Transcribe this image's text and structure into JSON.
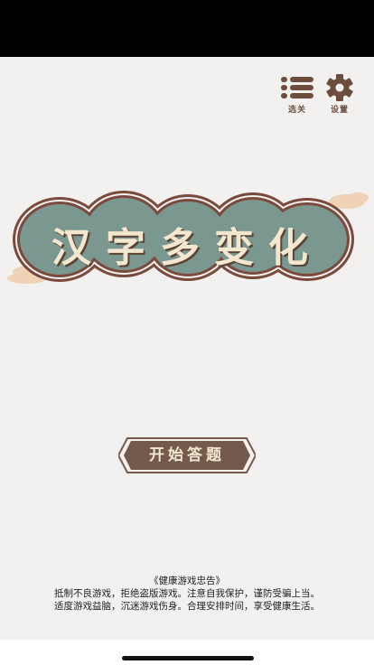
{
  "game": {
    "title": "汉字多变化",
    "start_label": "开始答题"
  },
  "top_buttons": {
    "levels_label": "选关",
    "settings_label": "设置"
  },
  "notice": {
    "heading": "《健康游戏忠告》",
    "line1": "抵制不良游戏，拒绝盗版游戏。注意自我保护，谨防受骗上当。",
    "line2": "适度游戏益脑，沉迷游戏伤身。合理安排时间，享受健康生活。"
  },
  "icons": {
    "levels": "list-icon",
    "settings": "gear-icon"
  },
  "colors": {
    "background": "#f2f1f0",
    "badge_fill": "#7a9790",
    "badge_border": "#7a4a3c",
    "cloud": "#f0d2b6",
    "button_fill": "#735a4c",
    "title_text": "#f3e7cf"
  }
}
